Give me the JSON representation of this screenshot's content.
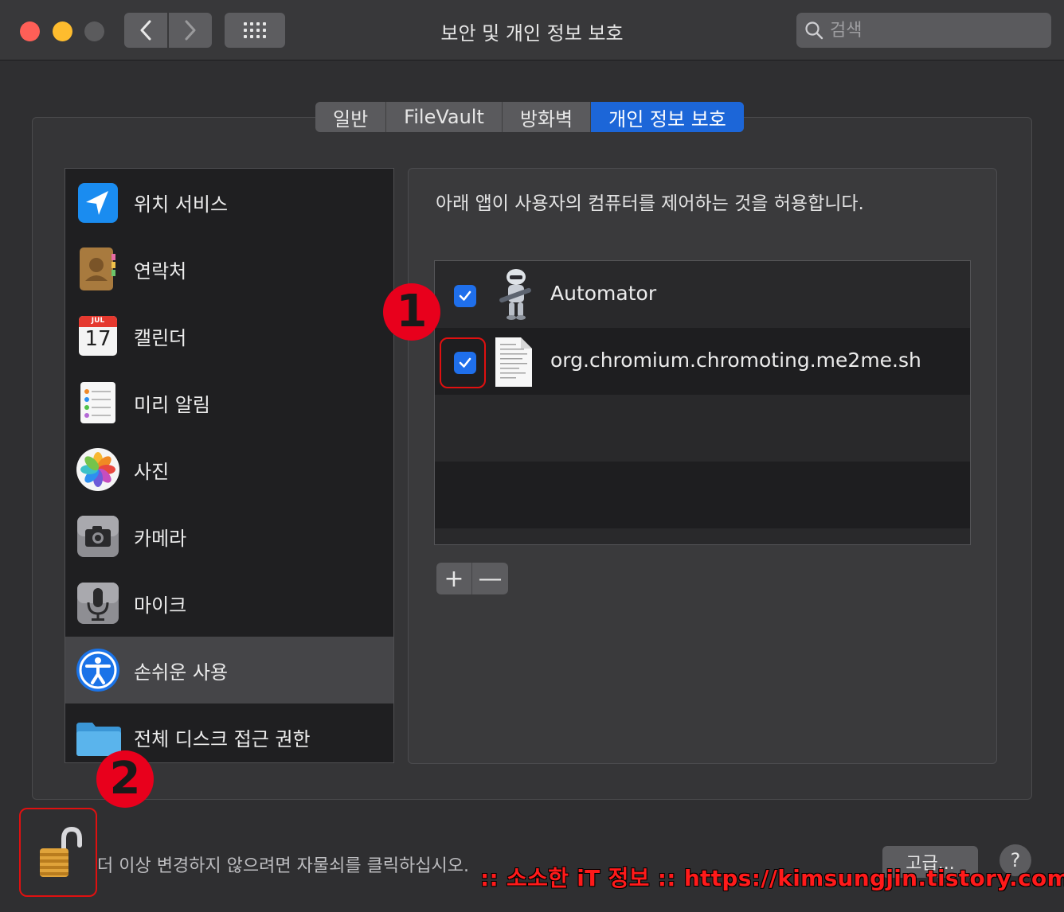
{
  "window": {
    "title": "보안 및 개인 정보 보호",
    "search_placeholder": "검색"
  },
  "tabs": [
    {
      "label": "일반",
      "active": false
    },
    {
      "label": "FileVault",
      "active": false
    },
    {
      "label": "방화벽",
      "active": false
    },
    {
      "label": "개인 정보 보호",
      "active": true
    }
  ],
  "sidebar": {
    "items": [
      {
        "label": "위치 서비스",
        "icon": "location-arrow-icon"
      },
      {
        "label": "연락처",
        "icon": "contacts-book-icon"
      },
      {
        "label": "캘린더",
        "icon": "calendar-icon",
        "month": "JUL",
        "day": "17"
      },
      {
        "label": "미리 알림",
        "icon": "reminders-icon"
      },
      {
        "label": "사진",
        "icon": "photos-icon"
      },
      {
        "label": "카메라",
        "icon": "camera-icon"
      },
      {
        "label": "마이크",
        "icon": "microphone-icon"
      },
      {
        "label": "손쉬운 사용",
        "icon": "accessibility-icon",
        "active": true
      },
      {
        "label": "전체 디스크 접근 권한",
        "icon": "folder-icon"
      }
    ]
  },
  "main": {
    "description": "아래 앱이 사용자의 컴퓨터를 제어하는 것을 허용합니다.",
    "apps": [
      {
        "name": "Automator",
        "checked": true,
        "icon": "automator-robot-icon"
      },
      {
        "name": "org.chromium.chromoting.me2me.sh",
        "checked": true,
        "icon": "document-icon"
      }
    ],
    "add_label": "+",
    "remove_label": "—"
  },
  "annotations": {
    "badge_1": "1",
    "badge_2": "2"
  },
  "footer": {
    "lock_text": "더 이상 변경하지 않으려면 자물쇠를 클릭하십시오.",
    "advanced_label": "고급...",
    "help_label": "?",
    "watermark": ":: 소소한 iT 정보 :: https://kimsungjin.tistory.com ::"
  },
  "colors": {
    "accent": "#1c66d8",
    "checkbox": "#1f6feb",
    "annotation_red": "#e8001c"
  }
}
